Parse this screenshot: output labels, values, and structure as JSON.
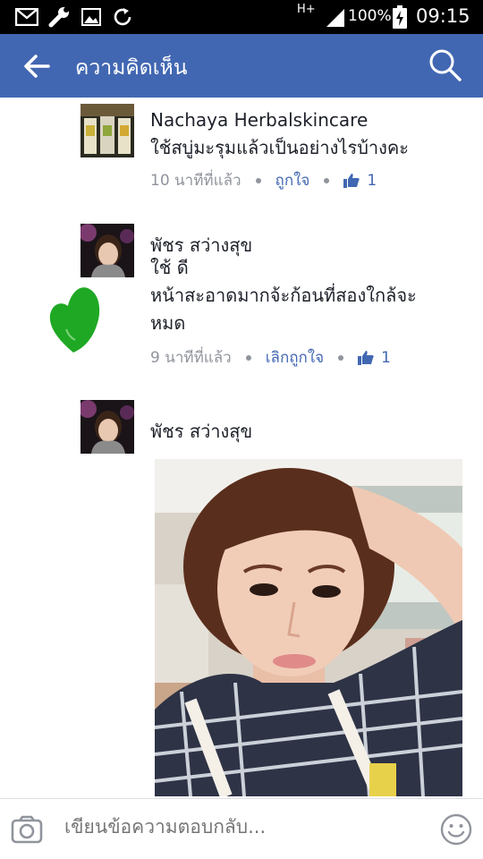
{
  "status_bar": {
    "network": "H+",
    "battery": "100%",
    "time": "09:15",
    "icons": [
      "mail-icon",
      "wrench-icon",
      "image-icon",
      "sync-icon",
      "signal-icon",
      "battery-icon"
    ]
  },
  "app_bar": {
    "title": "ความคิดเห็น",
    "icons": [
      "back-arrow-icon",
      "search-icon"
    ]
  },
  "comments": [
    {
      "name": "Nachaya Herbalskincare",
      "text": "ใช้สบู่มะรุมแล้วเป็นอย่างไรบ้างคะ",
      "time": "10 นาทีที่แล้ว",
      "like_label": "ถูกใจ",
      "like_count": "1"
    },
    {
      "name": "พัชร สว่างสุข",
      "text_line1": "ใช้ ดี",
      "text_line2": "หน้าสะอาดมากจ้ะก้อนที่สองใกล้จะ",
      "text_line3": "หมด",
      "time": "9 นาทีที่แล้ว",
      "like_label": "เลิกถูกใจ",
      "like_count": "1"
    },
    {
      "name": "พัชร สว่างสุข"
    }
  ],
  "composer": {
    "placeholder": "เขียนข้อความตอบกลับ...",
    "icons": [
      "camera-icon",
      "emoji-icon"
    ]
  },
  "colors": {
    "app_bar": "#4267b2",
    "link": "#4267b2",
    "meta": "#90949c",
    "heart_mark": "#1fa824"
  }
}
